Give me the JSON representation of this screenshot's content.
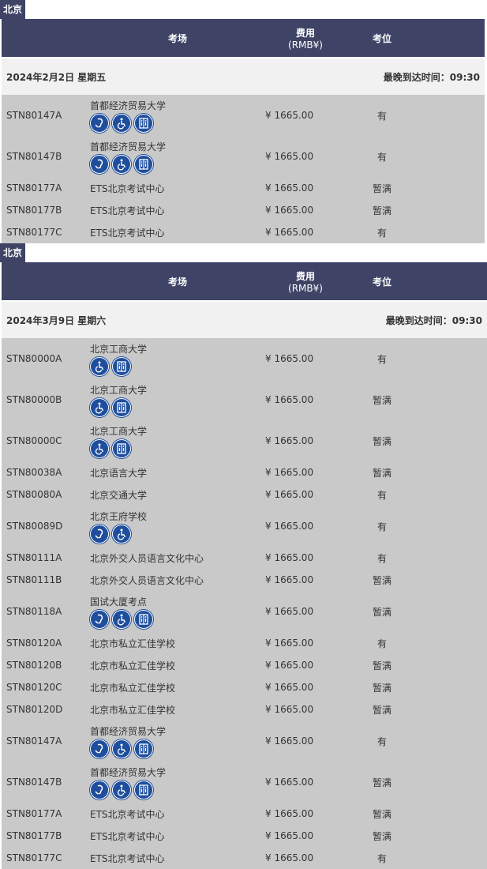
{
  "blocks": [
    {
      "city": "北京",
      "header": {
        "venue": "考场",
        "fee": "费用",
        "fee_unit": "(RMB¥)",
        "seat": "考位"
      },
      "date": "2024年2月2日 星期五",
      "latest_arrival": "最晚到达时间：09:30",
      "rows": [
        {
          "code": "STN80147A",
          "venue": "首都经济贸易大学",
          "icons": [
            "ear-icon",
            "wheelchair-icon",
            "elevator-icon"
          ],
          "fee": "¥ 1665.00",
          "seat": "有"
        },
        {
          "code": "STN80147B",
          "venue": "首都经济贸易大学",
          "icons": [
            "ear-icon",
            "wheelchair-icon",
            "elevator-icon"
          ],
          "fee": "¥ 1665.00",
          "seat": "有"
        },
        {
          "code": "STN80177A",
          "venue": "ETS北京考试中心",
          "icons": [],
          "fee": "¥ 1665.00",
          "seat": "暂满"
        },
        {
          "code": "STN80177B",
          "venue": "ETS北京考试中心",
          "icons": [],
          "fee": "¥ 1665.00",
          "seat": "暂满"
        },
        {
          "code": "STN80177C",
          "venue": "ETS北京考试中心",
          "icons": [],
          "fee": "¥ 1665.00",
          "seat": "有"
        }
      ]
    },
    {
      "city": "北京",
      "header": {
        "venue": "考场",
        "fee": "费用",
        "fee_unit": "(RMB¥)",
        "seat": "考位"
      },
      "date": "2024年3月9日 星期六",
      "latest_arrival": "最晚到达时间：09:30",
      "rows": [
        {
          "code": "STN80000A",
          "venue": "北京工商大学",
          "icons": [
            "wheelchair-icon",
            "elevator-icon"
          ],
          "fee": "¥ 1665.00",
          "seat": "有"
        },
        {
          "code": "STN80000B",
          "venue": "北京工商大学",
          "icons": [
            "wheelchair-icon",
            "elevator-icon"
          ],
          "fee": "¥ 1665.00",
          "seat": "暂满"
        },
        {
          "code": "STN80000C",
          "venue": "北京工商大学",
          "icons": [
            "wheelchair-icon",
            "elevator-icon"
          ],
          "fee": "¥ 1665.00",
          "seat": "暂满"
        },
        {
          "code": "STN80038A",
          "venue": "北京语言大学",
          "icons": [],
          "fee": "¥ 1665.00",
          "seat": "暂满"
        },
        {
          "code": "STN80080A",
          "venue": "北京交通大学",
          "icons": [],
          "fee": "¥ 1665.00",
          "seat": "有"
        },
        {
          "code": "STN80089D",
          "venue": "北京王府学校",
          "icons": [
            "ear-icon",
            "wheelchair-icon"
          ],
          "fee": "¥ 1665.00",
          "seat": "有"
        },
        {
          "code": "STN80111A",
          "venue": "北京外交人员语言文化中心",
          "icons": [],
          "fee": "¥ 1665.00",
          "seat": "有"
        },
        {
          "code": "STN80111B",
          "venue": "北京外交人员语言文化中心",
          "icons": [],
          "fee": "¥ 1665.00",
          "seat": "暂满"
        },
        {
          "code": "STN80118A",
          "venue": "国试大厦考点",
          "icons": [
            "ear-icon",
            "wheelchair-icon",
            "elevator-icon"
          ],
          "fee": "¥ 1665.00",
          "seat": "暂满"
        },
        {
          "code": "STN80120A",
          "venue": "北京市私立汇佳学校",
          "icons": [],
          "fee": "¥ 1665.00",
          "seat": "有"
        },
        {
          "code": "STN80120B",
          "venue": "北京市私立汇佳学校",
          "icons": [],
          "fee": "¥ 1665.00",
          "seat": "暂满"
        },
        {
          "code": "STN80120C",
          "venue": "北京市私立汇佳学校",
          "icons": [],
          "fee": "¥ 1665.00",
          "seat": "暂满"
        },
        {
          "code": "STN80120D",
          "venue": "北京市私立汇佳学校",
          "icons": [],
          "fee": "¥ 1665.00",
          "seat": "暂满"
        },
        {
          "code": "STN80147A",
          "venue": "首都经济贸易大学",
          "icons": [
            "ear-icon",
            "wheelchair-icon",
            "elevator-icon"
          ],
          "fee": "¥ 1665.00",
          "seat": "有"
        },
        {
          "code": "STN80147B",
          "venue": "首都经济贸易大学",
          "icons": [
            "ear-icon",
            "wheelchair-icon",
            "elevator-icon"
          ],
          "fee": "¥ 1665.00",
          "seat": "暂满"
        },
        {
          "code": "STN80177A",
          "venue": "ETS北京考试中心",
          "icons": [],
          "fee": "¥ 1665.00",
          "seat": "暂满"
        },
        {
          "code": "STN80177B",
          "venue": "ETS北京考试中心",
          "icons": [],
          "fee": "¥ 1665.00",
          "seat": "暂满"
        },
        {
          "code": "STN80177C",
          "venue": "ETS北京考试中心",
          "icons": [],
          "fee": "¥ 1665.00",
          "seat": "有"
        }
      ]
    }
  ],
  "colors": {
    "header_bg": "#3f4466",
    "row_bg": "#c9c9c9",
    "date_bg": "#f1f1f1",
    "icon_bg": "#1f4e9c"
  }
}
